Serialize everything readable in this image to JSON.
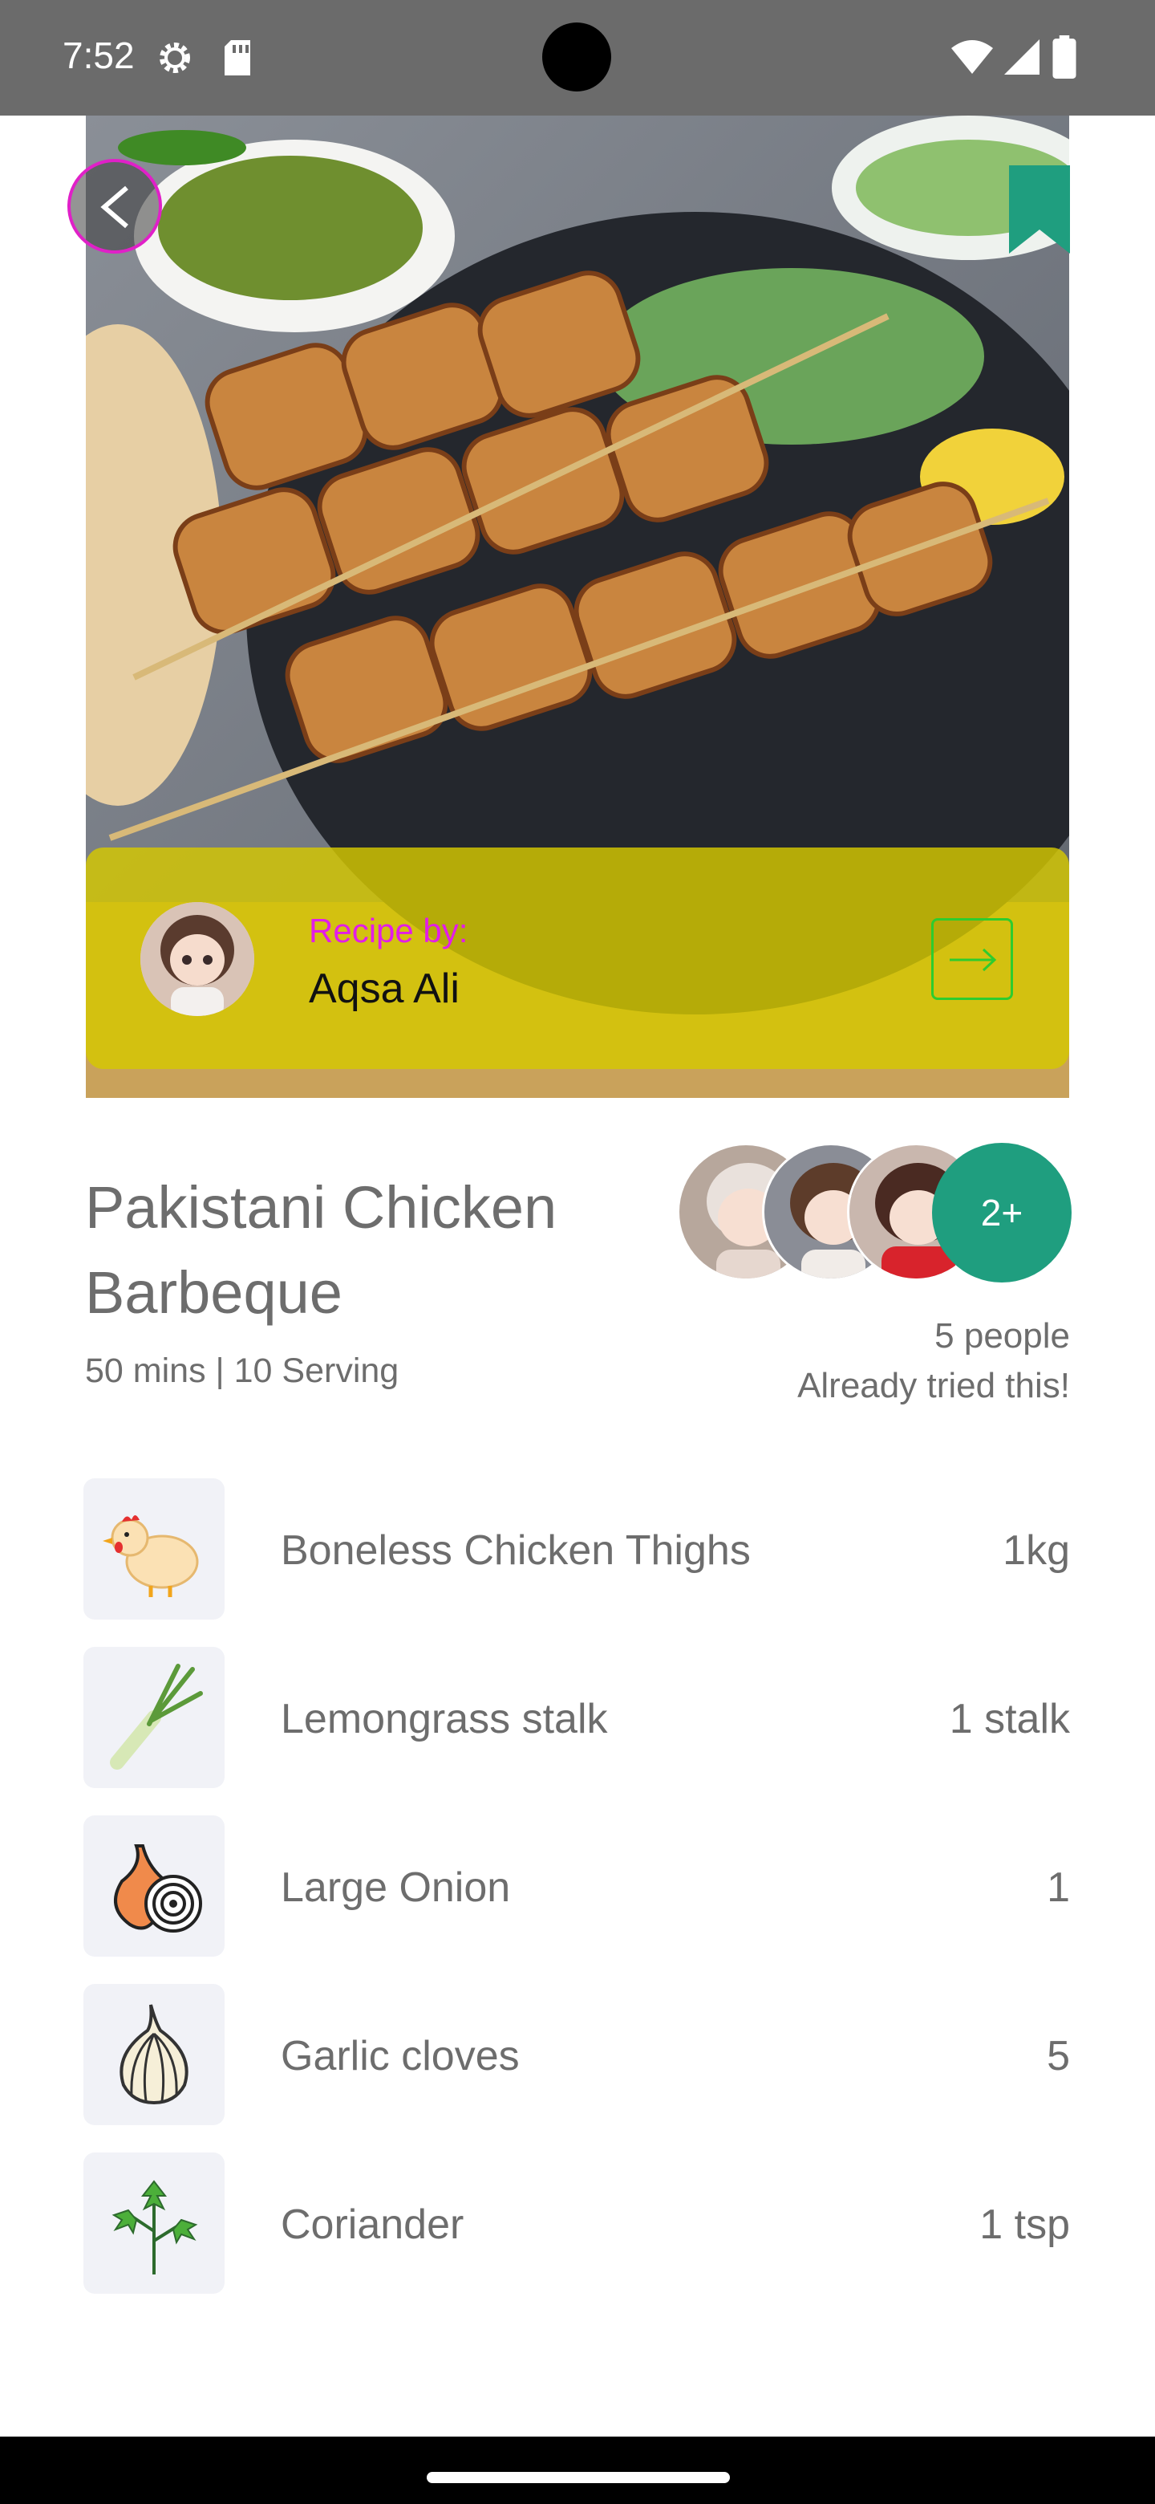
{
  "status_bar": {
    "time": "7:52"
  },
  "hero": {
    "recipe_by_label": "Recipe by:",
    "author_name": "Aqsa Ali"
  },
  "recipe": {
    "title": "Pakistani Chicken Barbeque",
    "meta": "50 mins | 10 Serving",
    "more_badge": "2+",
    "tried_count": "5 people",
    "tried_text": "Already tried this!"
  },
  "ingredients": [
    {
      "name": "Boneless Chicken Thighs",
      "qty": "1kg",
      "icon": "chicken-icon"
    },
    {
      "name": "Lemongrass stalk",
      "qty": "1 stalk",
      "icon": "lemongrass-icon"
    },
    {
      "name": "Large Onion",
      "qty": "1",
      "icon": "onion-icon"
    },
    {
      "name": "Garlic cloves",
      "qty": "5",
      "icon": "garlic-icon"
    },
    {
      "name": "Coriander",
      "qty": "1 tsp",
      "icon": "coriander-icon"
    }
  ],
  "colors": {
    "accent_green": "#1f9e7f",
    "recipe_by_pink": "#e21de8",
    "card_yellow": "#d6c800",
    "text_gray": "#6d6d6d"
  }
}
